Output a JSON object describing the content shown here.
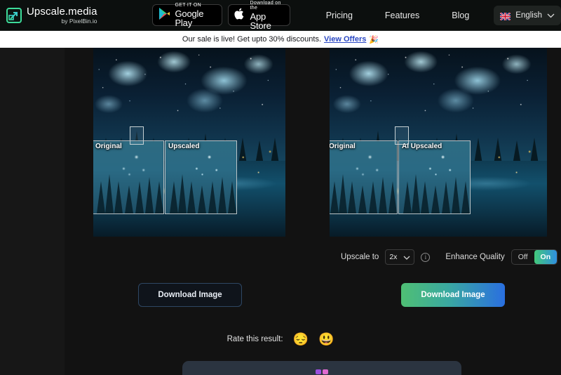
{
  "header": {
    "logo": {
      "name": "Upscale.media",
      "byline": "by PixelBin.io",
      "icon": "upscale-arrow-icon"
    },
    "store_buttons": [
      {
        "id": "google-play",
        "small": "GET IT ON",
        "big": "Google Play",
        "icon": "google-play-icon"
      },
      {
        "id": "app-store",
        "small": "Download on the",
        "big": "App Store",
        "icon": "apple-icon"
      }
    ],
    "nav": [
      {
        "id": "pricing",
        "label": "Pricing"
      },
      {
        "id": "features",
        "label": "Features"
      },
      {
        "id": "blog",
        "label": "Blog"
      }
    ],
    "language": {
      "label": "English",
      "flag": "uk-flag-icon",
      "chevron": "chevron-down-icon"
    }
  },
  "announcement": {
    "text": "Our sale is live! Get upto 30% discounts.",
    "link": "View Offers",
    "emoji": "🎉"
  },
  "comparison": {
    "left_panel": {
      "label_original": "Original",
      "label_result": "Upscaled",
      "download_label": "Download Image"
    },
    "right_panel": {
      "label_original": "Original",
      "label_result": "AI Upscaled",
      "download_label": "Download Image"
    }
  },
  "controls": {
    "upscale_label": "Upscale to",
    "upscale_value": "2x",
    "upscale_chevron": "chevron-down-icon",
    "upscale_info": "i",
    "enhance_label": "Enhance Quality",
    "enhance_off": "Off",
    "enhance_on": "On",
    "enhance_state": "On",
    "enhance_info": "i"
  },
  "rate": {
    "label": "Rate this result:",
    "options": [
      {
        "id": "rate-sad",
        "emoji": "😔"
      },
      {
        "id": "rate-happy",
        "emoji": "😃"
      }
    ]
  },
  "colors": {
    "accent_green": "#43c97a",
    "accent_blue": "#2a6fe0",
    "link_blue": "#2a48c4",
    "page_bg": "#121212",
    "header_bg": "#0c0f0e"
  }
}
